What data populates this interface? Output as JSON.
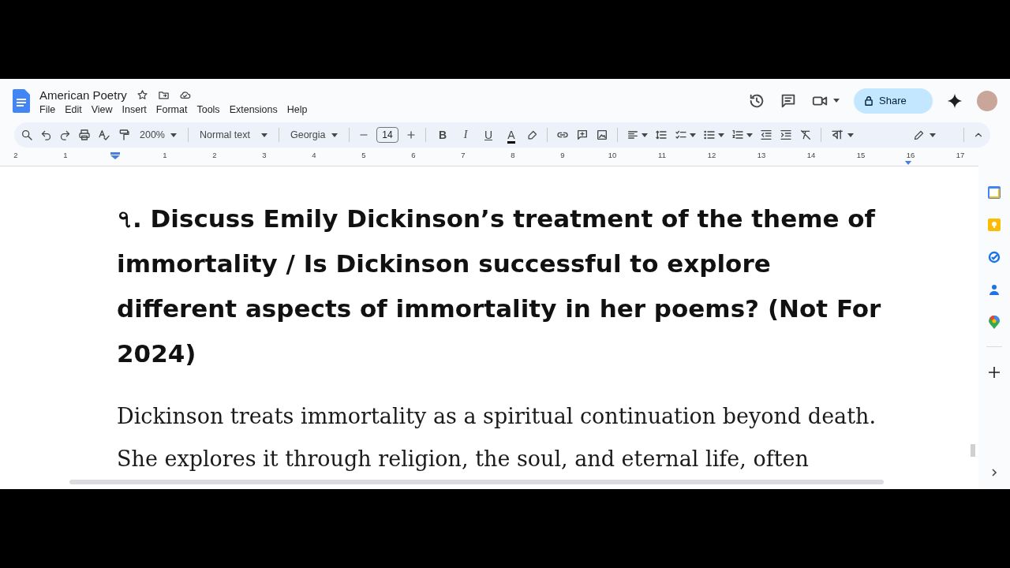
{
  "document_title": "American Poetry",
  "menu": [
    "File",
    "Edit",
    "View",
    "Insert",
    "Format",
    "Tools",
    "Extensions",
    "Help"
  ],
  "share_button": "Share",
  "toolbar": {
    "zoom": "200%",
    "style": "Normal text",
    "font": "Georgia",
    "font_size": "14",
    "bold": "B",
    "italic": "I",
    "underline": "U",
    "text_color": "A",
    "input_tool": "বা"
  },
  "ruler": {
    "left_labels": [
      "2",
      "1"
    ],
    "right_labels": [
      "1",
      "2",
      "3",
      "4",
      "5",
      "6",
      "7",
      "8",
      "9",
      "10",
      "11",
      "12",
      "13",
      "14",
      "15",
      "16",
      "17"
    ]
  },
  "heading": "৭. Discuss Emily Dickinson’s treatment of the theme of immortality / Is Dickinson successful to explore different aspects of immortality in her poems? (Not For 2024)",
  "paragraph_lines": [
    "Dickinson treats immortality as a spiritual continuation beyond death.",
    "She explores it through religion, the soul, and eternal life, often"
  ]
}
